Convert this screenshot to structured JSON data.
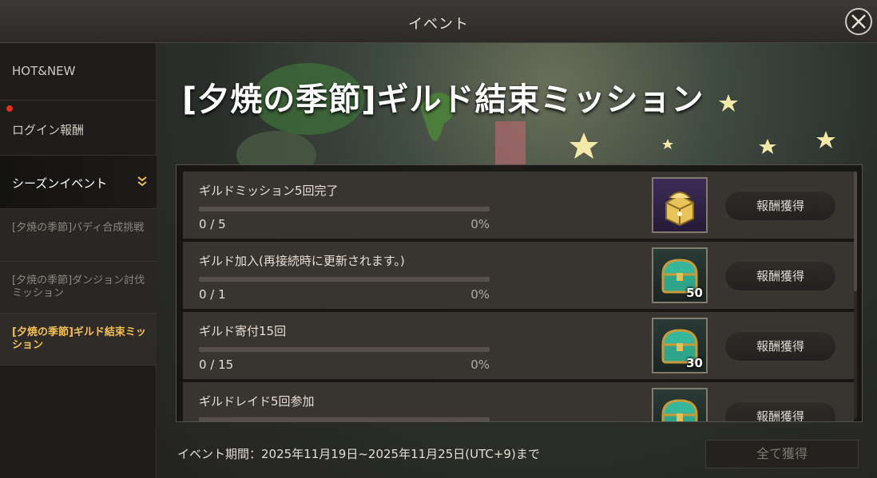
{
  "window": {
    "title": "イベント"
  },
  "sidebar": {
    "items": [
      {
        "label": "HOT&NEW"
      },
      {
        "label": "ログイン報酬",
        "has_notification": true
      },
      {
        "label": "シーズンイベント",
        "expanded": true
      }
    ],
    "sub_items": [
      {
        "label": "[夕焼の季節]バディ合成挑戦"
      },
      {
        "label": "[夕焼の季節]ダンジョン討伐ミッション"
      },
      {
        "label": "[夕焼の季節]ギルド結束ミッション",
        "selected": true
      }
    ]
  },
  "main": {
    "title": "[夕焼の季節]ギルド結束ミッション",
    "missions": [
      {
        "title": "ギルドミッション5回完了",
        "count": "0 / 5",
        "percent": "0%",
        "progress": 0,
        "reward_icon": "golden-chest-icon",
        "reward_qty": "",
        "button": "報酬獲得"
      },
      {
        "title": "ギルド加入(再接続時に更新されます。)",
        "count": "0 / 1",
        "percent": "0%",
        "progress": 0,
        "reward_icon": "teal-chest-icon",
        "reward_qty": "50",
        "button": "報酬獲得"
      },
      {
        "title": "ギルド寄付15回",
        "count": "0 / 15",
        "percent": "0%",
        "progress": 0,
        "reward_icon": "teal-chest-icon",
        "reward_qty": "30",
        "button": "報酬獲得"
      },
      {
        "title": "ギルドレイド5回参加",
        "count": "",
        "percent": "",
        "progress": 0,
        "reward_icon": "teal-chest-icon",
        "reward_qty": "",
        "button": "報酬獲得"
      }
    ],
    "event_period": "イベント期間：2025年11月19日~2025年11月25日(UTC+9)まで",
    "claim_all": "全て獲得"
  },
  "colors": {
    "accent": "#f2c057",
    "notification": "#e0301e",
    "progress": "#e2b458"
  }
}
